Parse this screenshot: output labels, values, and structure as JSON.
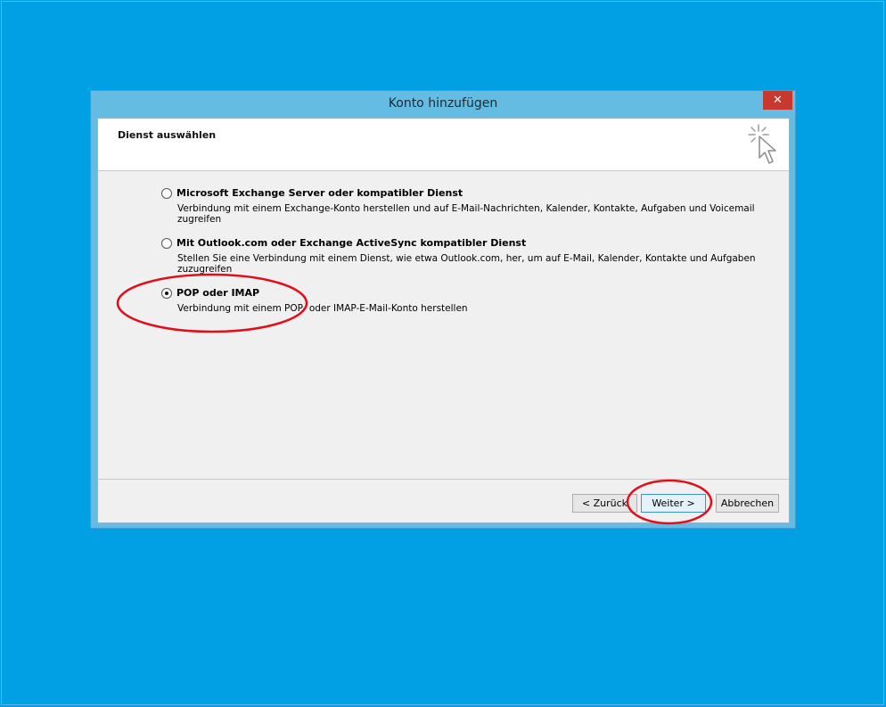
{
  "dialog": {
    "title": "Konto hinzufügen",
    "close_glyph": "✕",
    "header_title": "Dienst auswählen",
    "header_icon": "wizard-cursor-icon"
  },
  "options": [
    {
      "label": "Microsoft Exchange Server oder kompatibler Dienst",
      "description": "Verbindung mit einem Exchange-Konto herstellen und auf E-Mail-Nachrichten, Kalender, Kontakte, Aufgaben und Voicemail zugreifen",
      "selected": false
    },
    {
      "label": "Mit Outlook.com oder Exchange ActiveSync kompatibler Dienst",
      "description": "Stellen Sie eine Verbindung mit einem Dienst, wie etwa Outlook.com, her, um auf E-Mail, Kalender, Kontakte und Aufgaben zuzugreifen",
      "selected": false
    },
    {
      "label": "POP oder IMAP",
      "description": "Verbindung mit einem POP- oder IMAP-E-Mail-Konto herstellen",
      "selected": true
    }
  ],
  "buttons": {
    "back": "< Zurück",
    "next": "Weiter >",
    "cancel": "Abbrechen"
  },
  "colors": {
    "desktop": "#019fe4",
    "title_bar": "#64bce3",
    "close_button": "#c7392f",
    "annotation": "#e0101a"
  }
}
